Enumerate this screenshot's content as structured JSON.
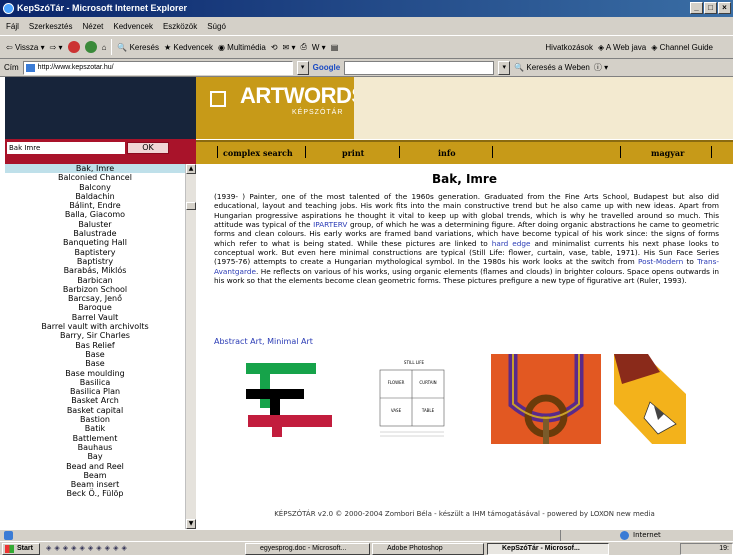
{
  "window": {
    "title": "KepSzóTár - Microsoft Internet Explorer",
    "min": "_",
    "max": "□",
    "close": "×"
  },
  "menu": [
    "Fájl",
    "Szerkesztés",
    "Nézet",
    "Kedvencek",
    "Eszközök",
    "Súgó"
  ],
  "toolbar": {
    "back": "Vissza",
    "search": "Keresés",
    "favorites": "Kedvencek",
    "media": "Multimédia",
    "links": "Hivatkozások",
    "link1": "A Web java",
    "link2": "Channel Guide"
  },
  "address": {
    "label": "Cím",
    "url": "http://www.kepszotar.hu/",
    "google": "Google",
    "web_search": "Keresés a Weben"
  },
  "site": {
    "logo": "ARTWORDS",
    "logo_sub": "KÉPSZÓTÁR",
    "nav": [
      "complex search",
      "print",
      "info",
      "magyar"
    ]
  },
  "search": {
    "value": "Bak Imre",
    "ok": "OK"
  },
  "list": [
    "Bak, Imre",
    "Balconied Chancel",
    "Balcony",
    "Baldachin",
    "Bálint, Endre",
    "Balla, Giacomo",
    "Baluster",
    "Balustrade",
    "Banqueting Hall",
    "Baptistery",
    "Baptistry",
    "Barabás, Miklós",
    "Barbican",
    "Barbizon School",
    "Barcsay, Jenő",
    "Baroque",
    "Barrel Vault",
    "Barrel vault with archivolts",
    "Barry, Sir Charles",
    "Bas Relief",
    "Base",
    "Base",
    "Base moulding",
    "Basilica",
    "Basilica Plan",
    "Basket Arch",
    "Basket capital",
    "Bastion",
    "Batik",
    "Battlement",
    "Bauhaus",
    "Bay",
    "Bead and Reel",
    "Beam",
    "Beam insert",
    "Beck Ö., Fülöp"
  ],
  "entry": {
    "title": "Bak, Imre",
    "p1": "(1939- ) Painter, one of the most talented of the 1960s generation. Graduated from the Fine Arts School, Budapest but also did educational, layout and teaching jobs. His work fits into the main constructive trend but he also came up with new ideas. Apart from Hungarian progressive aspirations he thought it vital to keep up with global trends, which is why he travelled around so much. This attitude was typical of the ",
    "link_iparterv": "IPARTERV",
    "p2": " group, of which he was a determining figure. After doing organic abstractions he came to geometric forms and clean colours. His early works are framed band variations, which have become typical of his work since: the signs of forms which refer to what is being stated. While these pictures are linked to ",
    "link_hardedge": "hard edge",
    "p3": " and minimalist currents his next phase looks to conceptual work. But even here minimal constructions are typical (Still Life: flower, curtain, vase, table, 1971). His Sun Face Series (1975-76) attempts to create a Hungarian mythological symbol. In the 1980s his work looks at the switch from ",
    "link_postmodern": "Post-Modern",
    "p4": " to ",
    "link_transavant": "Trans-Avantgarde",
    "p5": ". He reflects on various of his works, using organic elements (flames and clouds) in brighter colours. Space opens outwards in his work so that the elements become clean geometric forms. These pictures prefigure a new type of figurative art (Ruler, 1993).",
    "related1": "Abstract Art",
    "related_sep": ", ",
    "related2": "Minimal Art",
    "still_life": {
      "title": "STILL LIFE",
      "flower": "FLOWER",
      "curtain": "CURTAIN",
      "vase": "VASE",
      "table": "TABLE"
    }
  },
  "footer": "KÉPSZÓTÁR v2.0   © 2000-2004 Zombori Béla  -  készült a IHM támogatásával  -  powered by LOXON new media",
  "status": {
    "zone": "Internet"
  },
  "taskbar": {
    "start": "Start",
    "items": [
      "egyesprog.doc - Microsoft...",
      "Adobe Photoshop",
      "KepSzóTár - Microsof..."
    ],
    "clock": "19:"
  }
}
